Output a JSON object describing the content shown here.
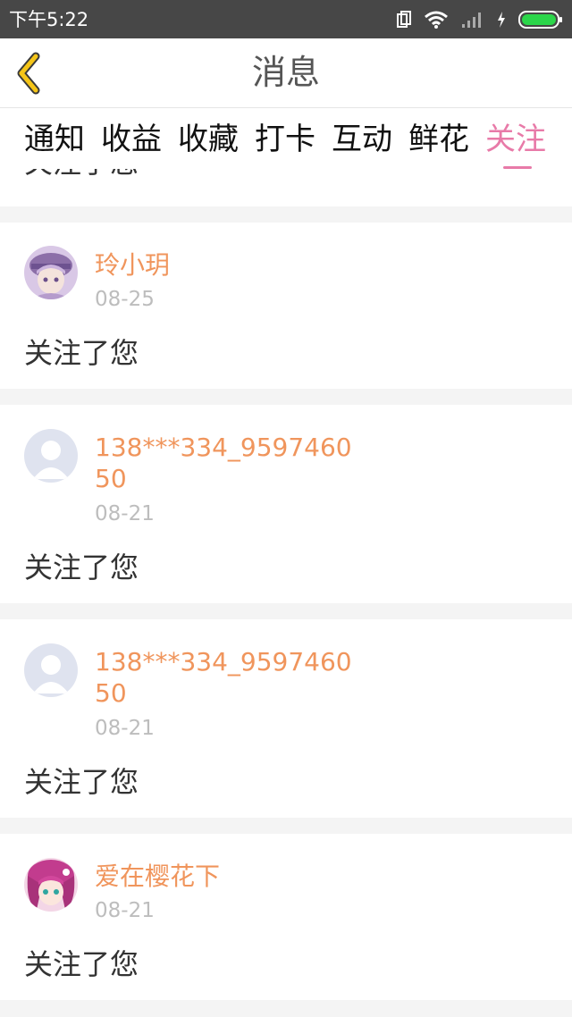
{
  "status_bar": {
    "time": "下午5:22",
    "icons": [
      "dual-sim-icon",
      "wifi-icon",
      "signal-icon",
      "charging-icon",
      "battery-icon"
    ],
    "battery_color": "#2bd64a"
  },
  "header": {
    "title": "消息",
    "back_icon": "chevron-left-icon",
    "back_color": "#f5c518"
  },
  "tabs": {
    "items": [
      {
        "label": "通知"
      },
      {
        "label": "收益"
      },
      {
        "label": "收藏"
      },
      {
        "label": "打卡"
      },
      {
        "label": "互动"
      },
      {
        "label": "鲜花"
      },
      {
        "label": "关注"
      }
    ],
    "active": "关注",
    "active_color": "#e87aa8"
  },
  "messages": {
    "partial_text": "关注了您",
    "items": [
      {
        "name": "玲小玥",
        "date": "08-25",
        "text": "关注了您",
        "avatar": "anime-avatar"
      },
      {
        "name": "138***334_959746050",
        "date": "08-21",
        "text": "关注了您",
        "avatar": "default-avatar"
      },
      {
        "name": "138***334_959746050",
        "date": "08-21",
        "text": "关注了您",
        "avatar": "default-avatar"
      },
      {
        "name": "爱在樱花下",
        "date": "08-21",
        "text": "关注了您",
        "avatar": "anime-avatar"
      }
    ],
    "name_color": "#f0955c"
  }
}
